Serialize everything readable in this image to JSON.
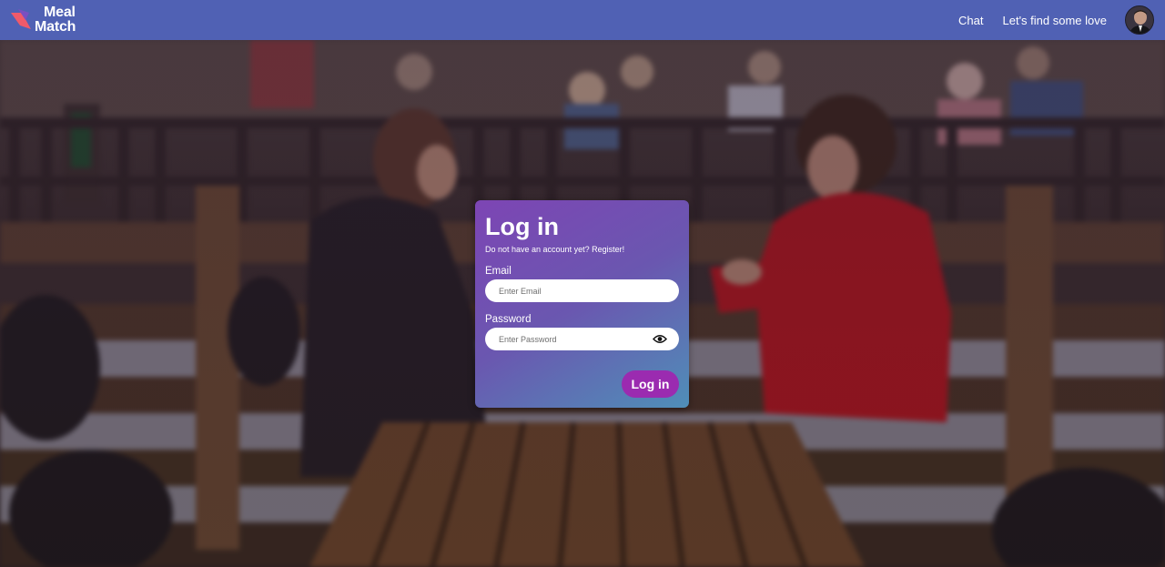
{
  "nav": {
    "brand_line1": "Meal",
    "brand_line2": "Match",
    "links": [
      "Chat",
      "Let's find some love"
    ],
    "avatar_icon": "user-avatar"
  },
  "login": {
    "title": "Log in",
    "register_text": "Do not have an account yet? Register!",
    "email_label": "Email",
    "email_placeholder": "Enter Email",
    "email_value": "",
    "password_label": "Password",
    "password_placeholder": "Enter Password",
    "password_value": "",
    "submit_label": "Log in",
    "password_toggle_icon": "eye-icon"
  },
  "colors": {
    "nav_bg": "#5061b4",
    "card_gradient_start": "#7d45b4",
    "card_gradient_end": "#4f8fb8",
    "button_bg": "#9b2bb0",
    "logo_accent": "#f05a6a"
  }
}
